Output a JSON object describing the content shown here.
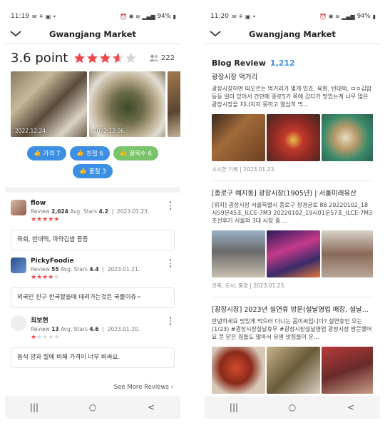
{
  "left": {
    "status": {
      "time": "11:19",
      "battery": "94%"
    },
    "header": {
      "title": "Gwangjang Market"
    },
    "rating": {
      "score": "3.6",
      "unit": "point",
      "stars_value": 3.6,
      "reviewer_count": "222"
    },
    "photos": [
      {
        "date": "2022.12.24."
      },
      {
        "date": "2022.12.06."
      },
      {
        "date": ""
      }
    ],
    "tags": [
      {
        "label": "가격 7",
        "color": "blue"
      },
      {
        "label": "친절 6",
        "color": "blue"
      },
      {
        "label": "꿀목수 6",
        "color": "green"
      },
      {
        "label": "품질 3",
        "color": "blue"
      }
    ],
    "reviews": [
      {
        "name": "flow",
        "review_label": "Review",
        "review_count": "2,024",
        "avg_label": "Avg. Stars",
        "avg": "4.2",
        "date": "2023.01.23.",
        "stars": 5,
        "text": "육회, 빈대떡, 마약김밥 등등"
      },
      {
        "name": "PickyFoodie",
        "review_label": "Review",
        "review_count": "55",
        "avg_label": "Avg. Stars",
        "avg": "4.4",
        "date": "2023.01.21.",
        "stars": 4,
        "text": "외국인 친구 한국왔을때 데려가는것은 국룰이쥬~"
      },
      {
        "name": "최보현",
        "review_label": "Review",
        "review_count": "13",
        "avg_label": "Avg. Stars",
        "avg": "4.6",
        "date": "2023.01.20.",
        "stars": 1,
        "text": "음식 양과 질에 비해 가격이 너무 비싸요."
      }
    ],
    "see_more": "See More Reviews"
  },
  "right": {
    "status": {
      "time": "11:20",
      "battery": "94%"
    },
    "header": {
      "title": "Gwangjang Market"
    },
    "blog": {
      "label": "Blog Review",
      "count": "1,212"
    },
    "posts": [
      {
        "title": "광장시장 먹거리",
        "snippet": "광장시장하면 떠오르는 먹거리가 몇개 있죠. 육회, 빈대떡, ㅁㅇ김밥 등등 일이 있어서 간만에 종로5가 쪽에 갔다가 맛있는게 너무 많은 광장시장을 지나치지 못하고 열심히 먹...",
        "meta": "소소한 기록  |  2023.01.23."
      },
      {
        "title": "[종로구 예지동] 광장시장(1905년) | 서울미래유산",
        "snippet": "[위치] 광장시장 서울특별시 종로구 창경궁로 88 20220102_18시59분45초_ILCE-7M3 20220102_19시01분57초_ILCE-7M3 조선후기 서울의 3대 시장 중 ...",
        "meta": "건축, 도시, 풍경  |  2023.01.23."
      },
      {
        "title": "[광장시장] 2023년 설연휴 방문(설날영업 매장, 설날...",
        "snippet": "만녕하세요 맛있게 먹으러 다니는 꼼이씨입니다? 설연휴인 오는(1/23) #광장시장설날휴무 #광장시장설날영업 광장시장 방문했어요 문 닫은 집들도 많아서 유명 맛집들이 운...",
        "meta": ""
      }
    ]
  },
  "nav": {
    "recent": "|||",
    "home": "○",
    "back": "<"
  },
  "colors": {
    "accent": "#3d8fe4",
    "star": "#f0474b",
    "green_tag": "#79c36b"
  }
}
